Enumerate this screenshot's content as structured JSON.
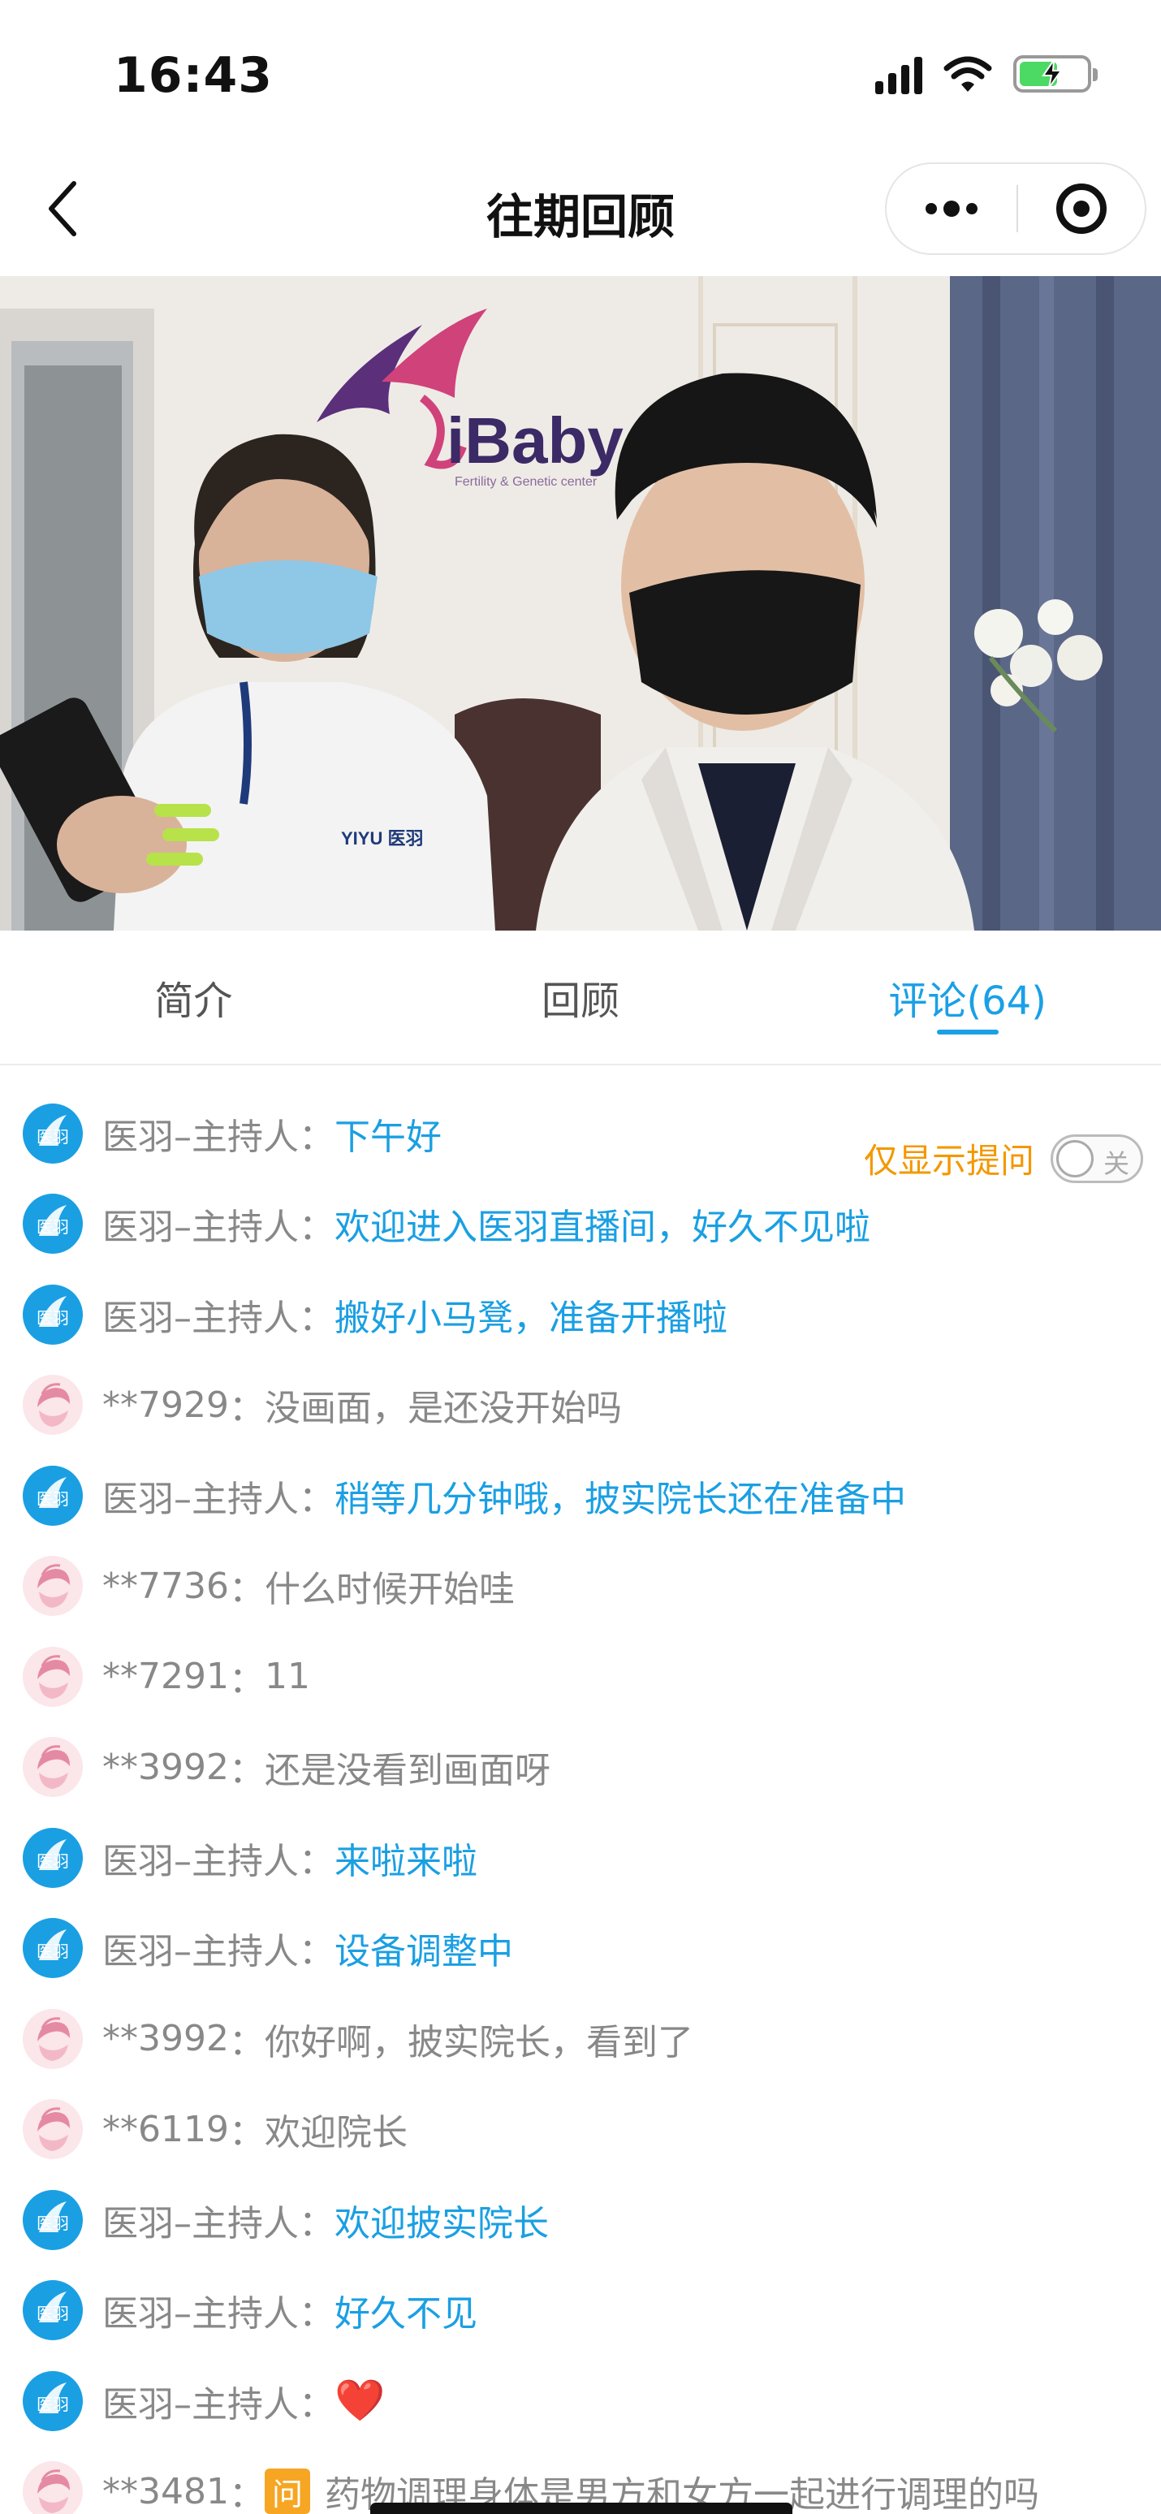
{
  "status_bar": {
    "time": "16:43"
  },
  "nav": {
    "title": "往期回顾"
  },
  "video": {
    "logo_text": "iBaby",
    "logo_subtext": "Fertility & Genetic center",
    "shirt_text": "YIYU 医羽"
  },
  "tabs": [
    {
      "label": "简介",
      "active": false
    },
    {
      "label": "回顾",
      "active": false
    },
    {
      "label": "评论(64)",
      "active": true
    }
  ],
  "filter": {
    "label": "仅显示提问",
    "toggle_text": "关"
  },
  "comments": [
    {
      "role": "host",
      "name": "医羽–主持人",
      "sep": "：",
      "text": "下午好"
    },
    {
      "role": "host",
      "name": "医羽–主持人",
      "sep": "：",
      "text": "欢迎进入医羽直播间，好久不见啦"
    },
    {
      "role": "host",
      "name": "医羽–主持人",
      "sep": "：",
      "text": "搬好小马凳，准备开播啦"
    },
    {
      "role": "user",
      "name": "**7929",
      "sep": "：",
      "text": "没画面，是还没开始吗"
    },
    {
      "role": "host",
      "name": "医羽–主持人",
      "sep": "：",
      "text": "稍等几分钟哦，披实院长还在准备中"
    },
    {
      "role": "user",
      "name": "**7736",
      "sep": "：",
      "text": "什么时候开始哇"
    },
    {
      "role": "user",
      "name": "**7291",
      "sep": "：",
      "text": "11"
    },
    {
      "role": "user",
      "name": "**3992",
      "sep": "：",
      "text": "还是没看到画面呀"
    },
    {
      "role": "host",
      "name": "医羽–主持人",
      "sep": "：",
      "text": "来啦来啦"
    },
    {
      "role": "host",
      "name": "医羽–主持人",
      "sep": "：",
      "text": "设备调整中"
    },
    {
      "role": "user",
      "name": "**3992",
      "sep": "：",
      "text": "你好啊，披实院长，看到了"
    },
    {
      "role": "user",
      "name": "**6119",
      "sep": "：",
      "text": "欢迎院长"
    },
    {
      "role": "host",
      "name": "医羽–主持人",
      "sep": "：",
      "text": "欢迎披实院长"
    },
    {
      "role": "host",
      "name": "医羽–主持人",
      "sep": "：",
      "text": "好久不见"
    },
    {
      "role": "host",
      "name": "医羽–主持人",
      "sep": "：",
      "text": "❤️"
    },
    {
      "role": "user",
      "name": "**3481",
      "sep": "：",
      "text": "药物调理身体是男方和女方一起进行调理的吗",
      "badge": "问"
    }
  ],
  "colors": {
    "accent": "#1aa0e6",
    "filter_label": "#f39800",
    "question_badge": "#f6a623"
  }
}
